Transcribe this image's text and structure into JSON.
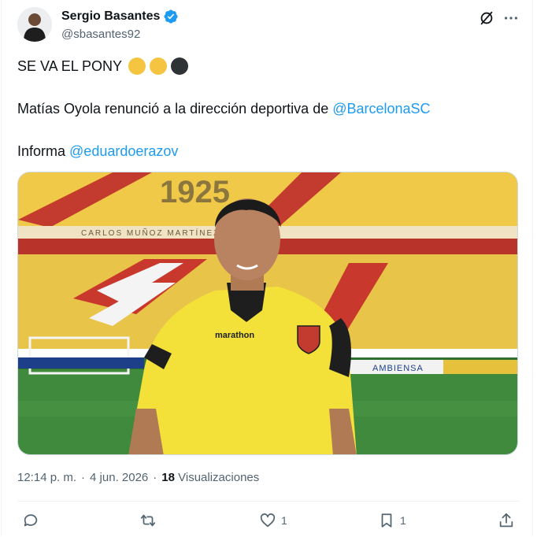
{
  "author": {
    "name": "Sergio Basantes",
    "handle": "@sbasantes92",
    "verified": true
  },
  "tweet": {
    "line1": "SE VA EL PONY",
    "line1_emojis": [
      "#f5c542",
      "#f5c542",
      "#2f3336"
    ],
    "line2_text": "Matías Oyola renunció a la dirección deportiva de ",
    "line2_mention": "@BarcelonaSC",
    "line3_text": "Informa ",
    "line3_mention": "@eduardoerazov"
  },
  "media": {
    "stadium_text": "1925",
    "stand_text": "CARLOS   MUÑOZ   MARTÍNEZ",
    "board_text": "AMBIENSA",
    "shirt_brand": "marathon"
  },
  "meta": {
    "time": "12:14 p. m.",
    "separator": "·",
    "date": "4 jun. 2026",
    "views_count": "18",
    "views_label": "Visualizaciones"
  },
  "actions": {
    "reply_count": "",
    "retweet_count": "",
    "like_count": "1",
    "bookmark_count": "1"
  },
  "colors": {
    "accent": "#1d9bf0",
    "secondary_text": "#536471"
  }
}
